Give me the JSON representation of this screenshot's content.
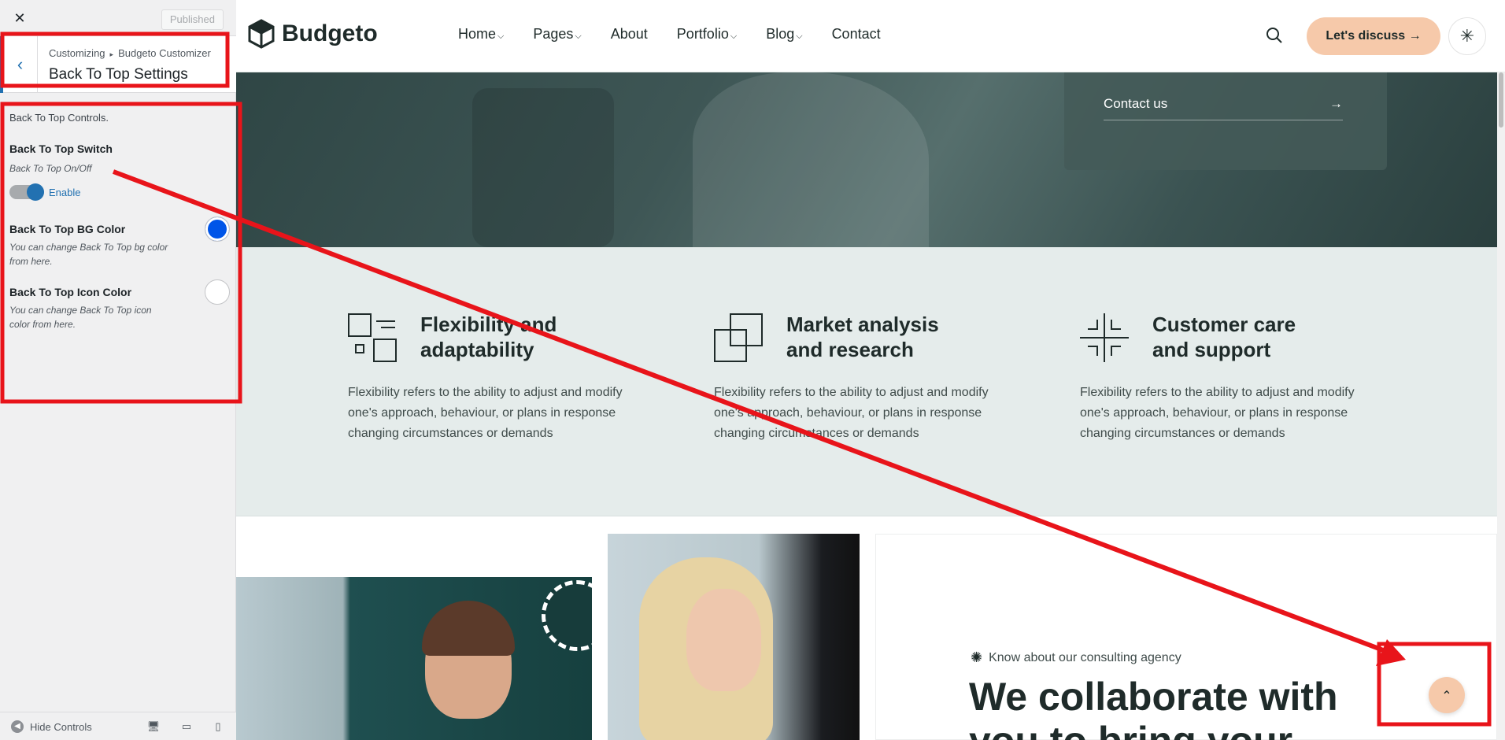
{
  "sidebar": {
    "close_icon": "close-icon",
    "published_label": "Published",
    "breadcrumb_root": "Customizing",
    "breadcrumb_separator": "▸",
    "breadcrumb_current": "Budgeto Customizer",
    "section_title": "Back To Top Settings",
    "section_description": "Back To Top Controls.",
    "switch": {
      "label": "Back To Top Switch",
      "description": "Back To Top On/Off",
      "state_label": "Enable"
    },
    "bg_color": {
      "label": "Back To Top BG Color",
      "description_line1": "You can change Back To Top bg color",
      "description_line2": "from here.",
      "value": "#0055e8"
    },
    "icon_color": {
      "label": "Back To Top Icon Color",
      "description_line1": "You can change Back To Top icon",
      "description_line2": "color from here.",
      "value": "#ffffff"
    },
    "footer": {
      "hide_controls_label": "Hide Controls"
    }
  },
  "site": {
    "logo_text": "Budgeto",
    "menu": [
      {
        "label": "Home",
        "has_dropdown": true
      },
      {
        "label": "Pages",
        "has_dropdown": true
      },
      {
        "label": "About",
        "has_dropdown": false
      },
      {
        "label": "Portfolio",
        "has_dropdown": true
      },
      {
        "label": "Blog",
        "has_dropdown": true
      },
      {
        "label": "Contact",
        "has_dropdown": false
      }
    ],
    "cta_label": "Let's discuss →",
    "contact_link_label": "Contact us",
    "features": [
      {
        "title_line1": "Flexibility and",
        "title_line2": "adaptability",
        "desc": "Flexibility refers to the ability to adjust and modify one's approach, behaviour, or plans in response changing circumstances or demands"
      },
      {
        "title_line1": "Market analysis",
        "title_line2": "and research",
        "desc": "Flexibility refers to the ability to adjust and modify one's approach, behaviour, or plans in response changing circumstances or demands"
      },
      {
        "title_line1": "Customer care",
        "title_line2": "and support",
        "desc": "Flexibility refers to the ability to adjust and modify one's approach, behaviour, or plans in response changing circumstances or demands"
      }
    ],
    "eyebrow": "Know about our consulting agency",
    "heading": "We collaborate with you to bring your",
    "accent_color": "#f6c9aa"
  },
  "annotation_color": "#e8141a"
}
